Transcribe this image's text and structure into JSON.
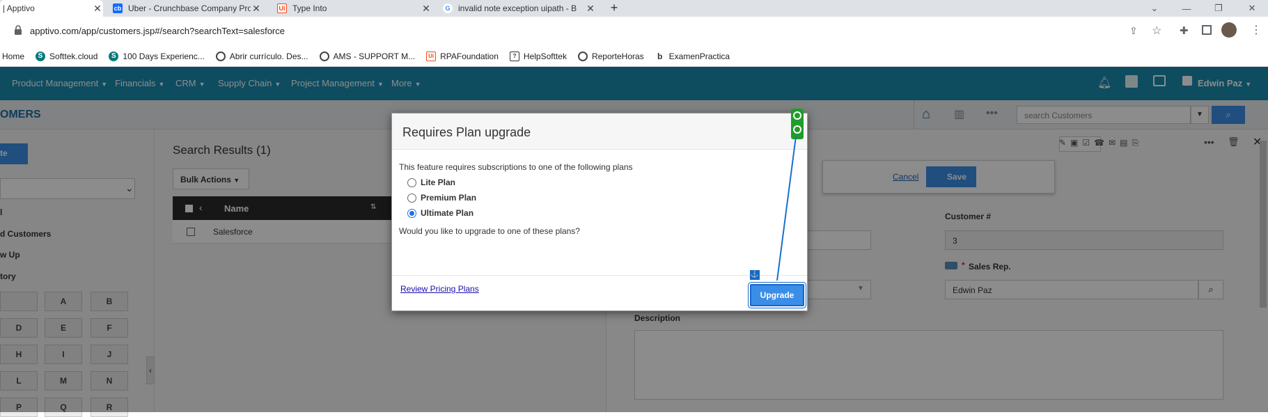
{
  "browser": {
    "tabs": [
      {
        "title": "| Apptivo",
        "favicon": "apptivo-icon",
        "active": true
      },
      {
        "title": "Uber - Crunchbase Company Pro",
        "favicon": "crunchbase-icon",
        "favicon_text": "cb"
      },
      {
        "title": "Type Into",
        "favicon": "uipath-icon",
        "favicon_text": "Ui"
      },
      {
        "title": "invalid note exception uipath - B",
        "favicon": "google-icon",
        "favicon_text": "G"
      }
    ],
    "new_tab_symbol": "+",
    "url": "apptivo.com/app/customers.jsp#/search?searchText=salesforce",
    "bookmarks": [
      {
        "label": "Home",
        "icon": "none"
      },
      {
        "label": "Softtek.cloud",
        "icon": "softtek-icon"
      },
      {
        "label": "100 Days Experienc...",
        "icon": "softtek-icon"
      },
      {
        "label": "Abrir currículo. Des...",
        "icon": "globe-icon"
      },
      {
        "label": "AMS - SUPPORT M...",
        "icon": "globe-icon"
      },
      {
        "label": "RPAFoundation",
        "icon": "uipath-icon"
      },
      {
        "label": "HelpSofttek",
        "icon": "help-icon"
      },
      {
        "label": "ReporteHoras",
        "icon": "globe-icon"
      },
      {
        "label": "ExamenPractica",
        "icon": "b-icon"
      }
    ]
  },
  "app": {
    "nav": [
      "Product Management",
      "Financials",
      "CRM",
      "Supply Chain",
      "Project Management",
      "More"
    ],
    "user": "Edwin Paz",
    "module_title": "OMERS",
    "search_placeholder": "search Customers",
    "sidebar": {
      "create_label": "te",
      "items": [
        "l",
        "d Customers",
        "w Up",
        "tory"
      ],
      "letters": [
        "",
        "A",
        "B",
        "D",
        "E",
        "F",
        "H",
        "I",
        "J",
        "L",
        "M",
        "N",
        "P",
        "Q",
        "R"
      ]
    },
    "results": {
      "title": "Search Results (1)",
      "bulk_actions": "Bulk Actions",
      "column_name": "Name",
      "rows": [
        "Salesforce"
      ]
    },
    "detail": {
      "cancel": "Cancel",
      "save": "Save",
      "customer_num_label": "Customer #",
      "customer_num_value": "3",
      "sales_rep_label": "Sales Rep.",
      "sales_rep_required": "*",
      "sales_rep_value": "Edwin Paz",
      "description_label": "Description"
    }
  },
  "modal": {
    "title": "Requires Plan upgrade",
    "intro": "This feature requires subscriptions to one of the following plans",
    "plans": [
      {
        "label": "Lite Plan",
        "selected": false
      },
      {
        "label": "Premium Plan",
        "selected": false
      },
      {
        "label": "Ultimate Plan",
        "selected": true
      }
    ],
    "question": "Would you like to upgrade to one of these plans?",
    "review_link": "Review Pricing Plans",
    "upgrade_button": "Upgrade"
  },
  "colors": {
    "nav_bg": "#1a8ab0",
    "button_blue": "#3b8ee8",
    "anchor_green": "#1f9d2a"
  }
}
